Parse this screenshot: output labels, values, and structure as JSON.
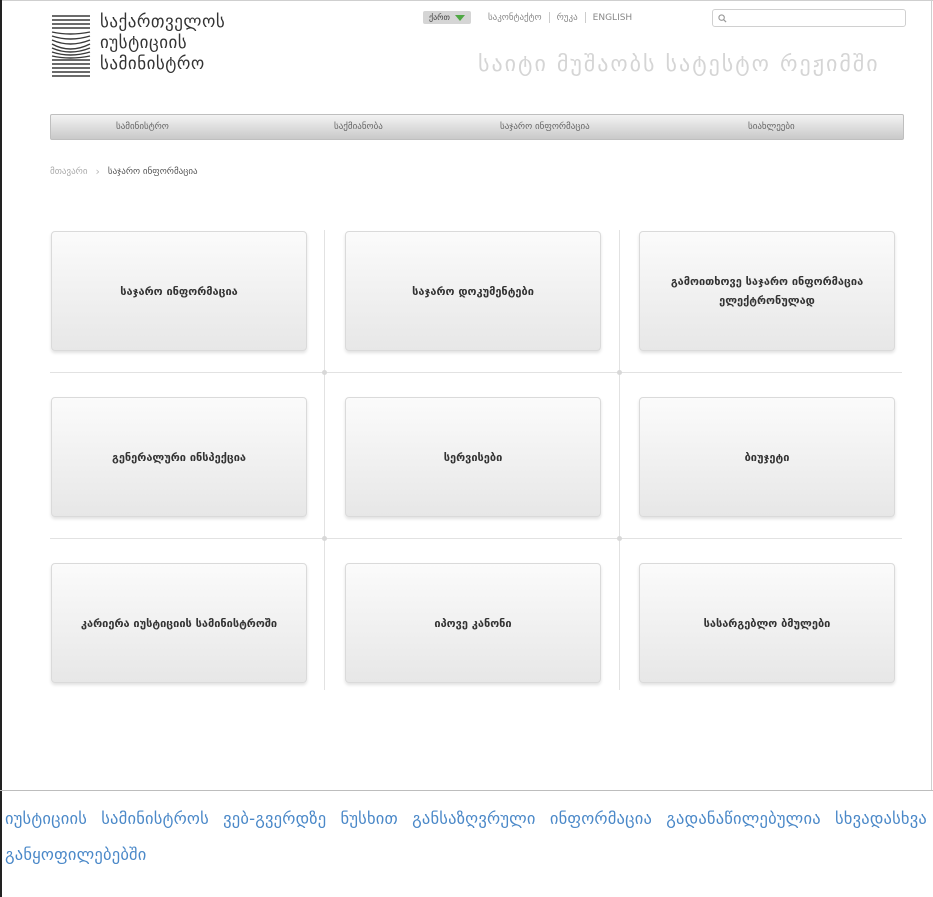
{
  "header": {
    "logo_lines": [
      "საქართველოს",
      "იუსტიციის",
      "სამინისტრო"
    ],
    "lang_selected": "ქართ",
    "top_links": [
      "საკონტაქტო",
      "რუკა",
      "ENGLISH"
    ],
    "search_placeholder": "",
    "tagline": "საიტი მუშაობს სატესტო რეჟიმში",
    "accent_color": "#4fa844"
  },
  "menu": [
    "სამინისტრო",
    "საქმიანობა",
    "საჯარო ინფორმაცია",
    "სიახლეები"
  ],
  "breadcrumb": {
    "home": "მთავარი",
    "current": "საჯარო ინფორმაცია"
  },
  "cards": [
    "საჯარო ინფორმაცია",
    "საჯარო დოკუმენტები",
    "გამოითხოვე საჯარო ინფორმაცია ელექტრონულად",
    "გენერალური ინსპექცია",
    "სერვისები",
    "ბიუჯეტი",
    "კარიერა იუსტიციის სამინისტროში",
    "იპოვე კანონი",
    "სასარგებლო ბმულები"
  ],
  "caption": "იუსტიციის სამინისტროს ვებ-გვერდზე ნუსხით განსაზღვრული ინფორმაცია გადანაწილებულია სხვადასხვა განყოფილებებში",
  "caption_color": "#4a88c8"
}
